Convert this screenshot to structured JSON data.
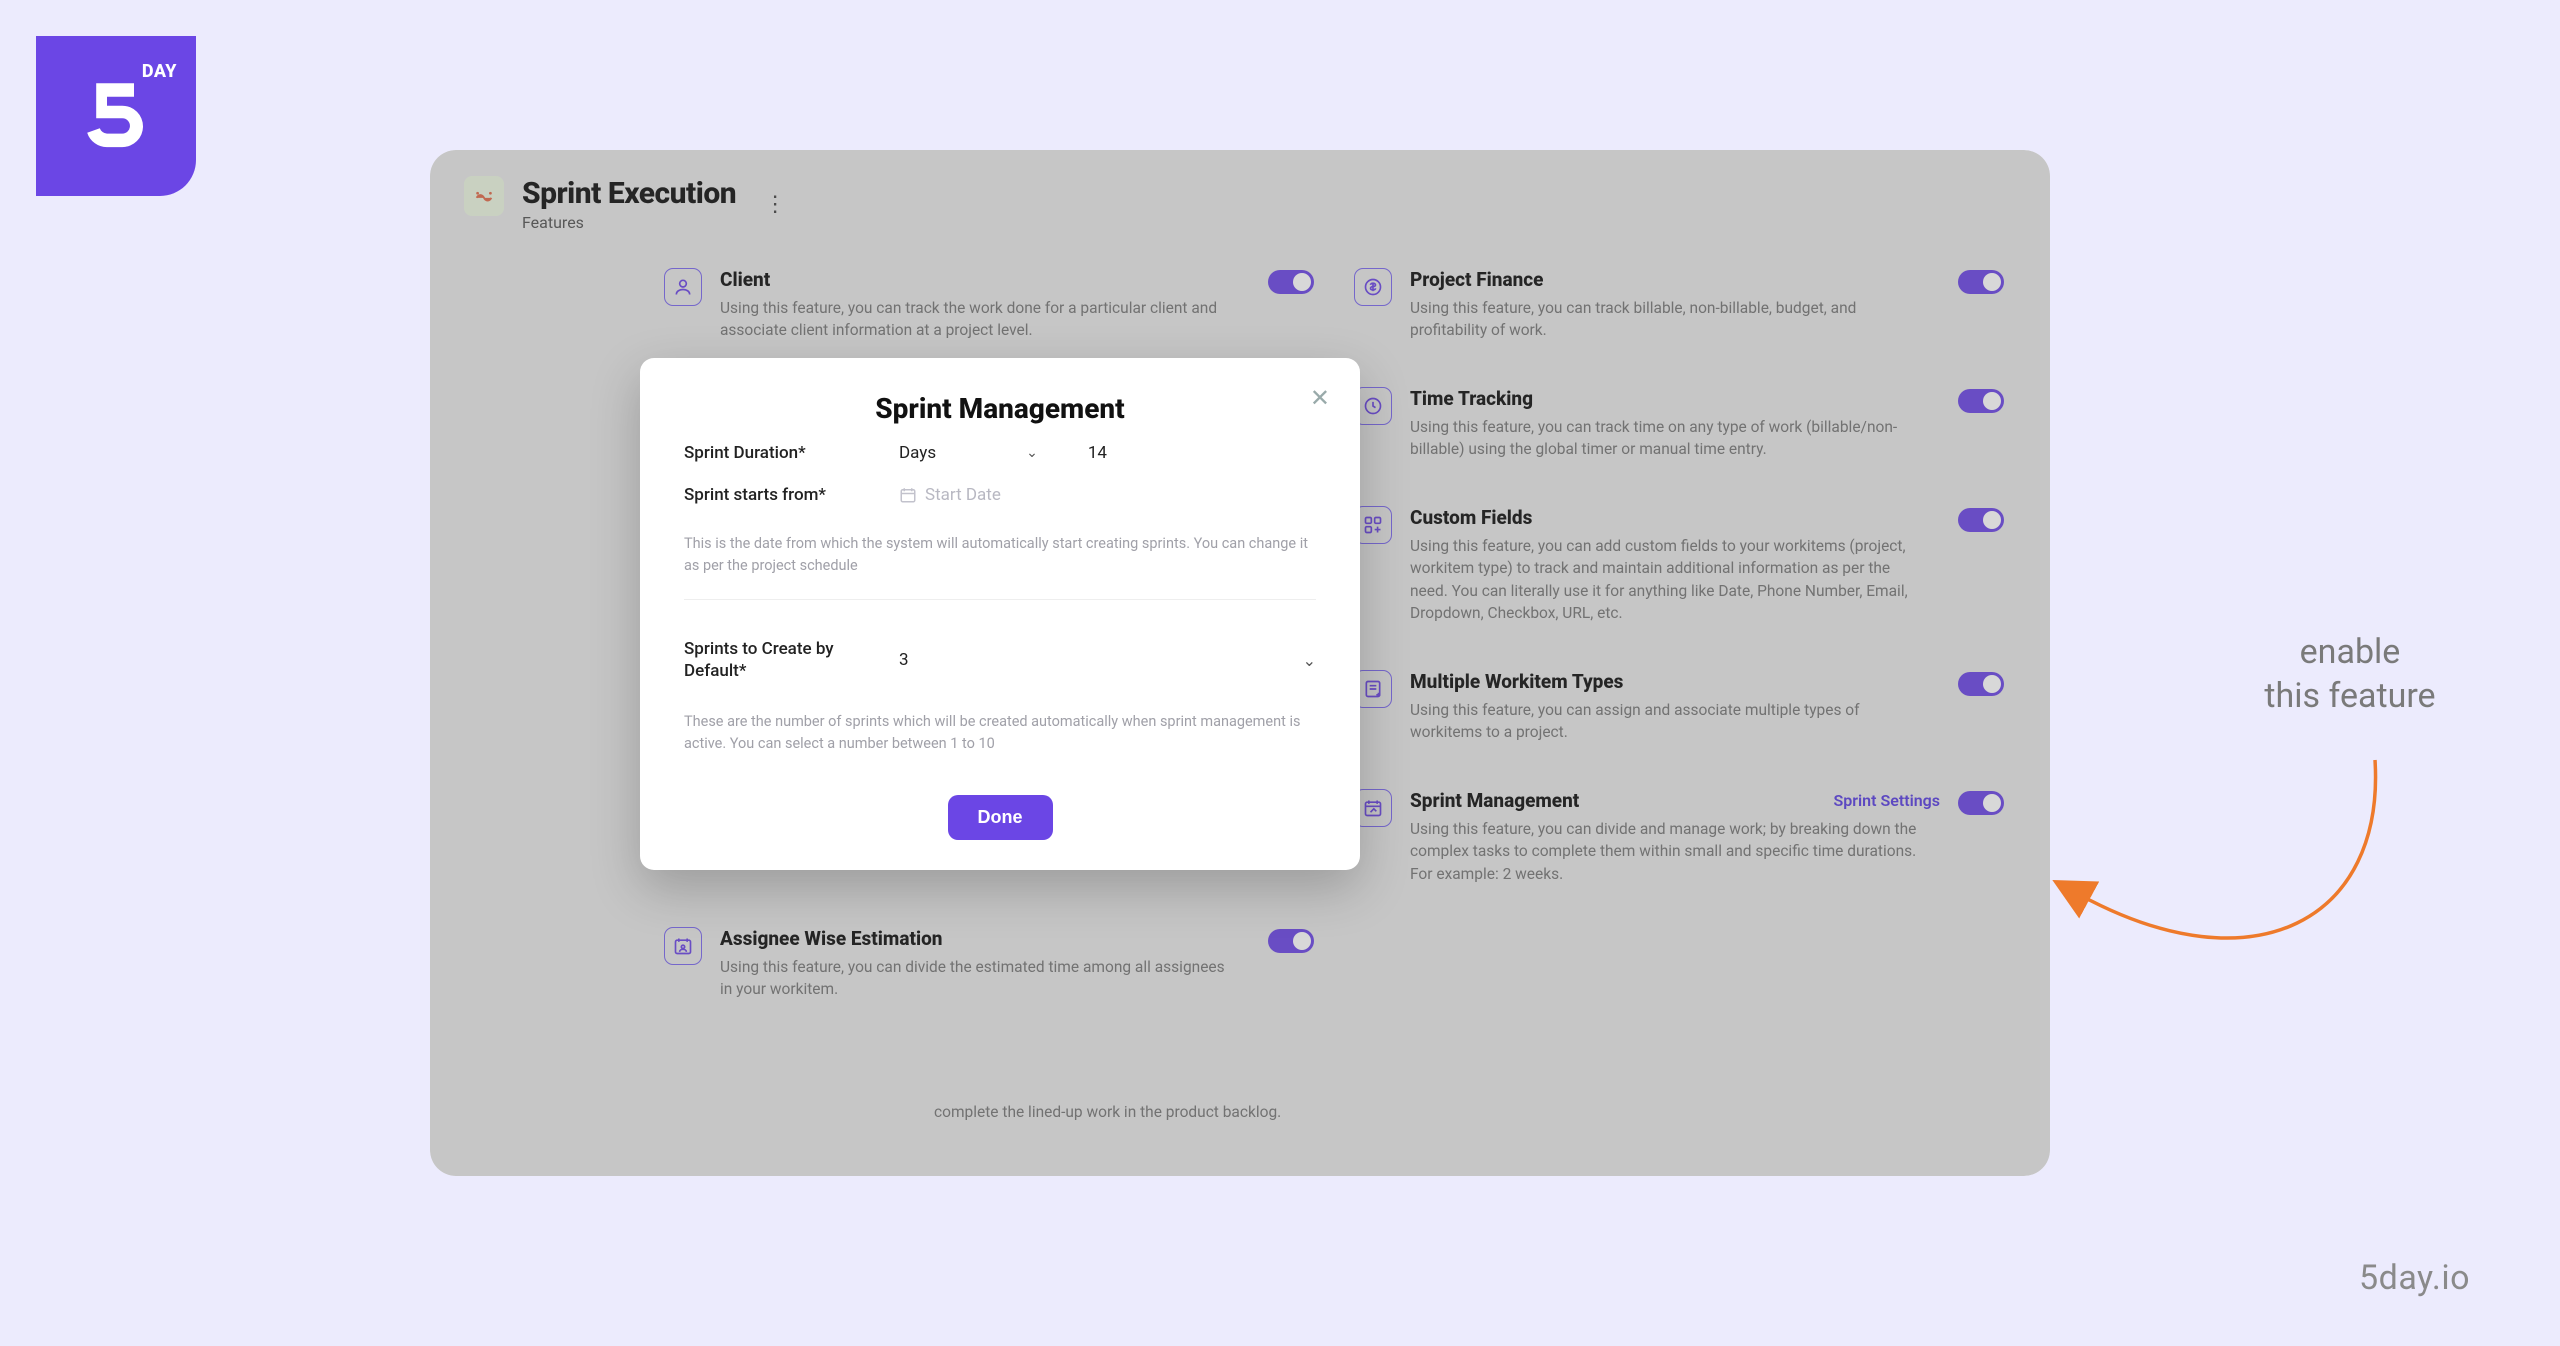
{
  "logo": {
    "day": "DAY"
  },
  "page": {
    "title": "Sprint Execution",
    "subtitle": "Features"
  },
  "annotation": {
    "text": "enable\nthis feature"
  },
  "credit": "5day.io",
  "features_left": [
    {
      "icon": "person",
      "title": "Client",
      "desc": "Using this feature, you can track the work done for a particular client and associate client information at a project level."
    },
    {
      "icon": "",
      "title": "",
      "desc": ""
    },
    {
      "icon": "",
      "title": "",
      "desc": ""
    },
    {
      "icon": "",
      "title": "",
      "desc": ""
    },
    {
      "icon": "",
      "title": "",
      "desc": "complete the lined-up work in the product backlog."
    },
    {
      "icon": "cal-person",
      "title": "Assignee Wise Estimation",
      "desc": "Using this feature, you can divide the estimated time among all assignees in your workitem."
    }
  ],
  "features_right": [
    {
      "icon": "dollar",
      "title": "Project Finance",
      "desc": "Using this feature, you can track billable, non-billable, budget, and profitability of work."
    },
    {
      "icon": "clock",
      "title": "Time Tracking",
      "desc": "Using this feature, you can track time on any type of work (billable/non-billable) using the global timer or manual time entry."
    },
    {
      "icon": "grid-plus",
      "title": "Custom Fields",
      "desc": "Using this feature, you can add custom fields to your workitems (project, workitem type) to track and maintain additional information as per the need. You can literally use it for anything like Date, Phone Number, Email, Dropdown, Checkbox, URL, etc."
    },
    {
      "icon": "doc-plus",
      "title": "Multiple Workitem Types",
      "desc": "Using this feature, you can assign and associate multiple types of workitems to a project."
    },
    {
      "icon": "sprint",
      "title": "Sprint Management",
      "link": "Sprint Settings",
      "desc": "Using this feature, you can divide and manage work; by breaking down the complex tasks to complete them within small and specific time durations. For example: 2 weeks."
    }
  ],
  "modal": {
    "title": "Sprint Management",
    "duration_label": "Sprint Duration*",
    "duration_unit": "Days",
    "duration_value": "14",
    "start_label": "Sprint starts from*",
    "start_placeholder": "Start Date",
    "start_help": "This is the date from which the system will automatically start creating sprints. You can change it as per the project schedule",
    "count_label": "Sprints to Create by Default*",
    "count_value": "3",
    "count_help": "These are the number of sprints which will be created automatically when sprint management is active. You can select a number between 1 to 10",
    "done": "Done"
  },
  "cutoff_left": "complete the lined-up work in the product backlog."
}
